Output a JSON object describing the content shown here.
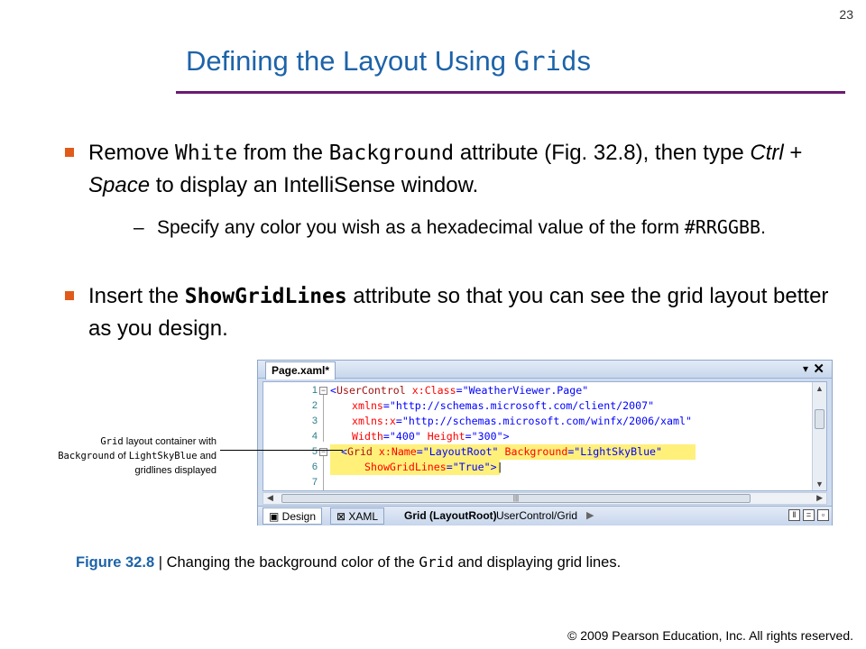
{
  "page_number": "23",
  "title": {
    "prefix": "Defining the Layout Using ",
    "code": "Grid",
    "suffix": "s"
  },
  "bullet1": {
    "t1": "Remove ",
    "c1": "White",
    "t2": " from the ",
    "c2": "Background",
    "t3": " attribute (Fig. 32.8), then type ",
    "i1": "Ctrl",
    "t4": " + ",
    "i2": "Space",
    "t5": " to display an IntelliSense window."
  },
  "sub1": {
    "dash": "–",
    "t1": "Specify any color you wish as a hexadecimal value of the form ",
    "c1": "#RRGGBB",
    "t2": "."
  },
  "bullet2": {
    "t1": "Insert the ",
    "c1": "ShowGridLines",
    "t2": " attribute so that you can see the grid layout better as you design."
  },
  "ide": {
    "doc_tab": "Page.xaml*",
    "pin_icon": "▾",
    "close_icon": "✕",
    "line_numbers": [
      "1",
      "2",
      "3",
      "4",
      "5",
      "6",
      "7"
    ],
    "code": {
      "l1_open": "<",
      "l1_tag": "UserControl",
      "l1_attr": " x:Class",
      "l1_eq": "=",
      "l1_val": "\"WeatherViewer.Page\"",
      "l2_attr": "xmlns",
      "l2_eq": "=",
      "l2_val": "\"http://schemas.microsoft.com/client/2007\"",
      "l3_attr": "xmlns:x",
      "l3_eq": "=",
      "l3_val": "\"http://schemas.microsoft.com/winfx/2006/xaml\"",
      "l4_attr1": "Width",
      "l4_eq1": "=",
      "l4_val1": "\"400\"",
      "l4_attr2": " Height",
      "l4_eq2": "=",
      "l4_val2": "\"300\"",
      "l4_close": ">",
      "l5_open": "<",
      "l5_tag": "Grid",
      "l5_attr1": " x:Name",
      "l5_eq1": "=",
      "l5_val1": "\"LayoutRoot\"",
      "l5_attr2": " Background",
      "l5_eq2": "=",
      "l5_val2": "\"LightSkyBlue\"",
      "l6_attr": "ShowGridLines",
      "l6_eq": "=",
      "l6_val": "\"True\"",
      "l6_close": ">"
    },
    "tab_design": "Design",
    "tab_xaml": "XAML",
    "crumb_grid": "Grid (LayoutRoot)",
    "crumb_path": "UserControl/Grid",
    "crumb_arrow": "▶"
  },
  "callout": {
    "c1": "Grid",
    "t1": " layout container with",
    "c2": "Background",
    "t2": " of ",
    "c3": "LightSkyBlue",
    "t3": " and",
    "t4": "gridlines displayed"
  },
  "caption": {
    "label": "Figure 32.8",
    "sep": " | ",
    "t1": "Changing the background color of the ",
    "c1": "Grid",
    "t2": " and displaying grid lines."
  },
  "copyright": "© 2009 Pearson Education, Inc.  All rights reserved."
}
